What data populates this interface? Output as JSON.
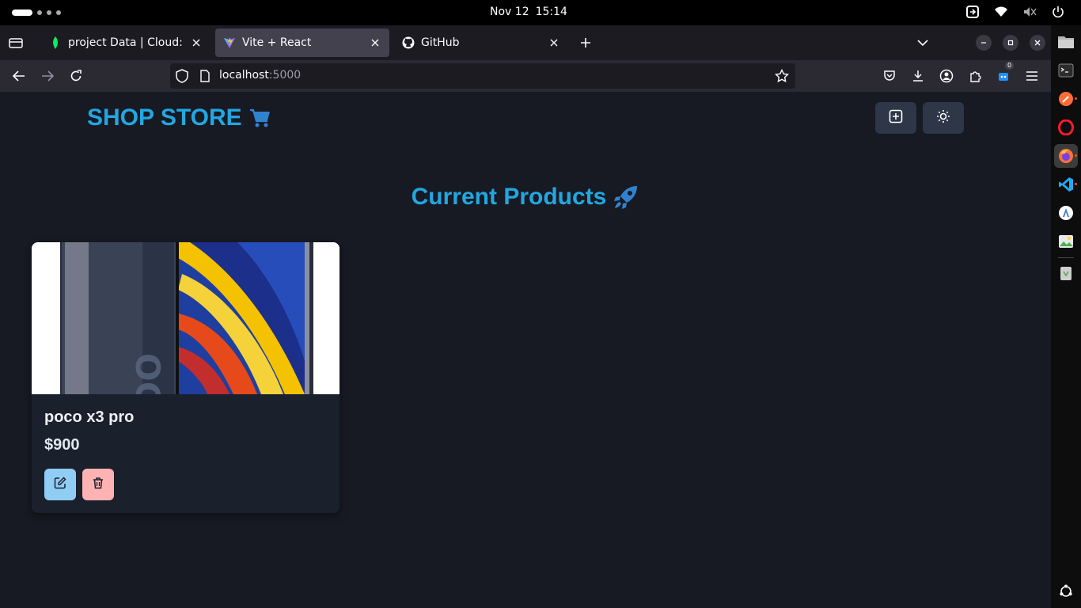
{
  "system": {
    "date": "Nov 12",
    "time": "15:14"
  },
  "browser": {
    "tabs": [
      {
        "title": "project Data | Cloud: Mo",
        "favicon": "mongodb-leaf-icon",
        "active": false
      },
      {
        "title": "Vite + React",
        "favicon": "vite-icon",
        "active": true
      },
      {
        "title": "GitHub",
        "favicon": "github-icon",
        "active": false
      }
    ],
    "url": {
      "host": "localhost",
      "port": ":5000"
    },
    "extensions_badge": "0"
  },
  "dock": {
    "items": [
      "files-icon",
      "terminal-icon",
      "postman-icon",
      "opera-icon",
      "firefox-icon",
      "vscode-icon",
      "appimage-icon",
      "image-viewer-icon",
      "trash-icon",
      "show-apps-icon"
    ]
  },
  "app": {
    "brand": "SHOP STORE",
    "brand_icon": "shopping-cart-icon",
    "header_buttons": [
      "add-square-icon",
      "sun-icon"
    ],
    "section_title": "Current Products",
    "section_icon": "rocket-icon",
    "accent": "#22a7e0",
    "products": [
      {
        "name": "poco x3 pro",
        "price": "$900",
        "edit_color": "#90cdf4",
        "delete_color": "#feb2b2"
      }
    ]
  }
}
